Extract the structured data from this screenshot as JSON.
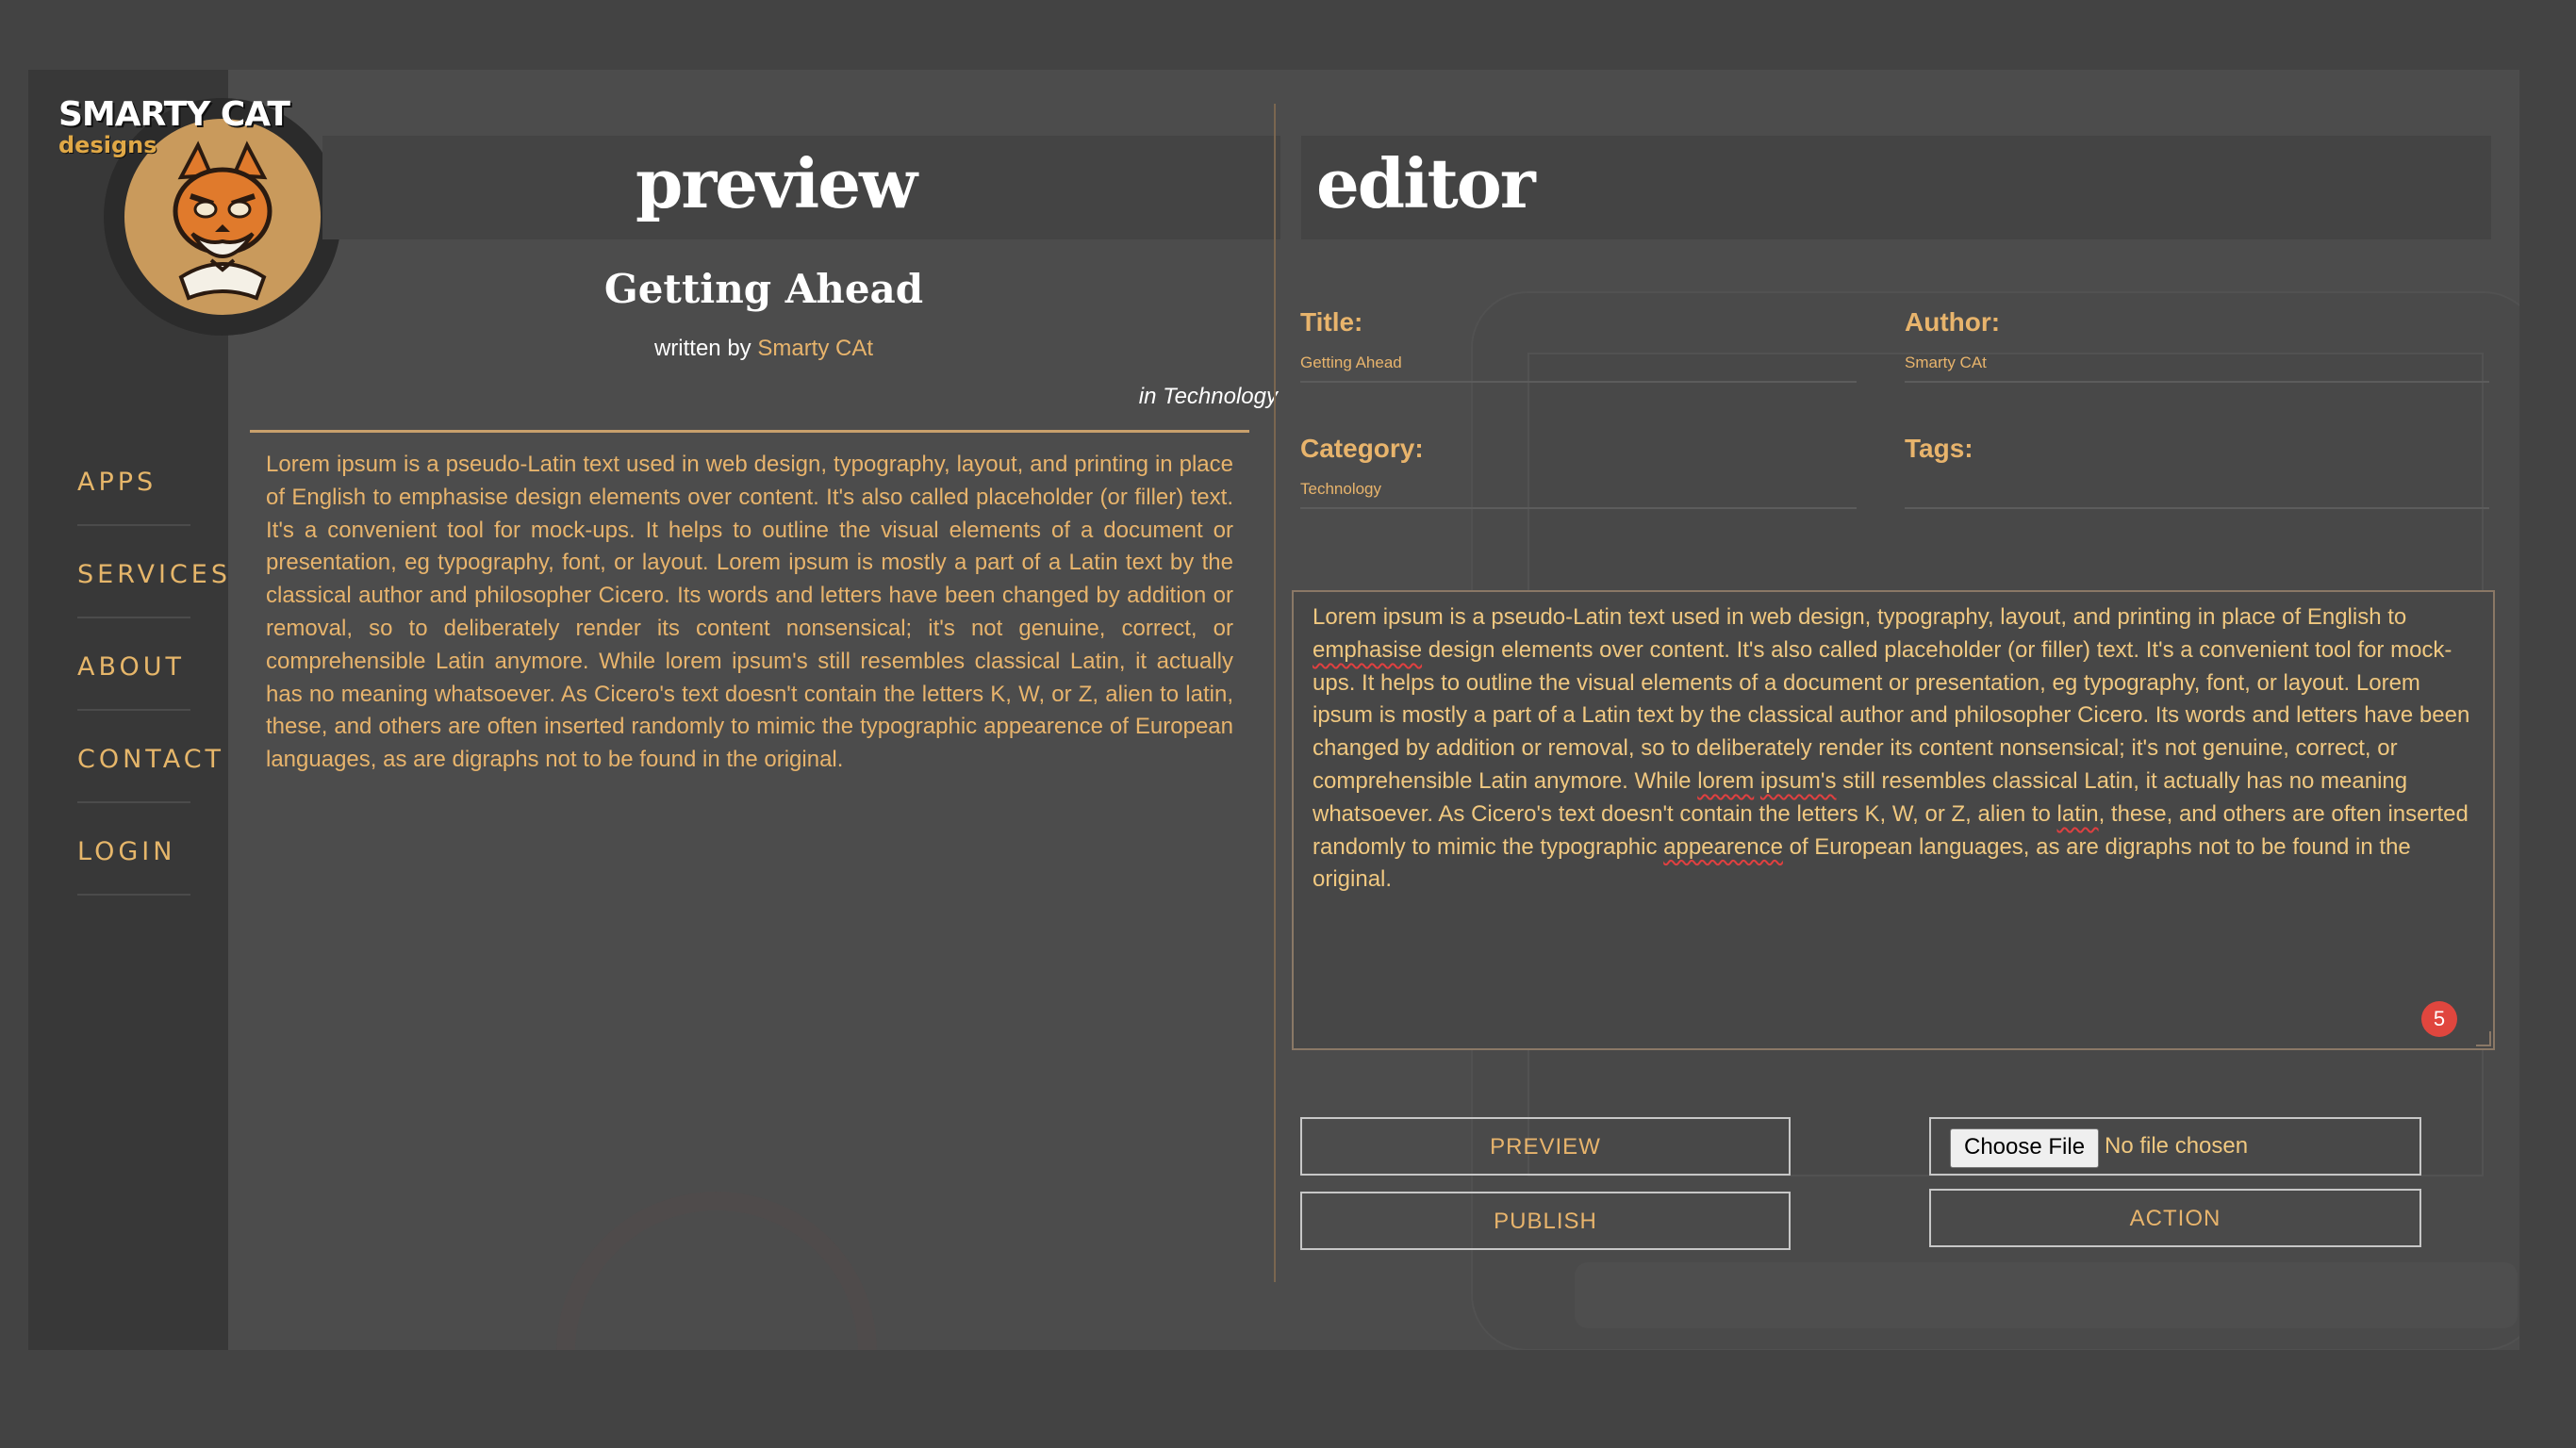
{
  "sidebar": {
    "logo": {
      "line1": "SMARTY CAT",
      "line2": "designs"
    },
    "nav": [
      {
        "label": "APPS"
      },
      {
        "label": "SERVICES"
      },
      {
        "label": "ABOUT"
      },
      {
        "label": "CONTACT"
      },
      {
        "label": "LOGIN"
      }
    ]
  },
  "preview": {
    "heading": "preview",
    "article_title": "Getting Ahead",
    "written_by": "written by",
    "author": "Smarty CAt",
    "category_line": "in Technology",
    "body": "Lorem ipsum is a pseudo-Latin text used in web design, typography, layout, and printing in place of English to emphasise design elements over content. It's also called placeholder (or filler) text. It's a convenient tool for mock-ups. It helps to outline the visual elements of a document or presentation, eg typography, font, or layout. Lorem ipsum is mostly a part of a Latin text by the classical author and philosopher Cicero. Its words and letters have been changed by addition or removal, so to deliberately render its content nonsensical; it's not genuine, correct, or comprehensible Latin anymore. While lorem ipsum's still resembles classical Latin, it actually has no meaning whatsoever. As Cicero's text doesn't contain the letters K, W, or Z, alien to latin, these, and others are often inserted randomly to mimic the typographic appearence of European languages, as are digraphs not to be found in the original."
  },
  "editor": {
    "heading": "editor",
    "title_label": "Title:",
    "title_value": "Getting Ahead",
    "author_label": "Author:",
    "author_value": "Smarty CAt",
    "category_label": "Category:",
    "category_value": "Technology",
    "tags_label": "Tags:",
    "tags_value": "",
    "content_segments": [
      "Lorem ipsum is a pseudo-Latin text used in web design, typography, layout, and printing in place of English to ",
      "emphasise",
      " design elements over content. It's also called placeholder (or filler) text. It's a convenient tool for mock-ups. It helps to outline the visual elements of a document or presentation, eg typography, font, or layout. Lorem ipsum is mostly a part of a Latin text by the classical author and philosopher Cicero. Its words and letters have been changed by addition or removal, so to deliberately render its content nonsensical; it's not genuine, correct, or comprehensible Latin anymore. While ",
      "lorem",
      " ",
      "ipsum's",
      " still resembles classical Latin, it actually has no meaning whatsoever. As Cicero's text doesn't contain the letters K, W, or Z, alien to ",
      "latin",
      ", these, and others are often inserted randomly to mimic the typographic ",
      "appearence",
      " of European languages, as are digraphs not to be found in the original."
    ],
    "spelling_error_count": "5",
    "preview_button": "PREVIEW",
    "publish_button": "PUBLISH",
    "choose_file_button": "Choose File",
    "no_file_text": "No file chosen",
    "action_button": "ACTION"
  },
  "colors": {
    "accent": "#e8b46c",
    "sidebar_bg": "#383838",
    "page_bg": "#4c4c4c",
    "spell_error": "#e04040"
  }
}
